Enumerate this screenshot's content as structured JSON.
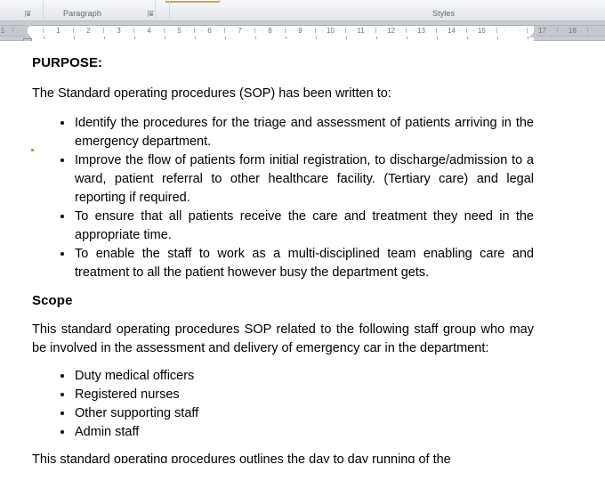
{
  "ribbon": {
    "groups": [
      {
        "label": "Paragraph",
        "launcher_icon": "dialog-launcher-icon"
      },
      {
        "label": "Styles",
        "launcher_icon": "dialog-launcher-icon"
      }
    ],
    "left_launcher_icon": "dialog-launcher-icon",
    "selected_style_thumbnail": "style-gallery-selected-thumbnail"
  },
  "ruler": {
    "unit_numbers": [
      "1",
      "2",
      "3",
      "4",
      "5",
      "6",
      "7",
      "8",
      "9",
      "10",
      "11",
      "12",
      "13",
      "14",
      "15",
      "17",
      "18"
    ],
    "minor_mark": "·",
    "medium_mark": "I",
    "left_indent_marker": "first-line-indent-marker",
    "hanging_indent_marker": "hanging-indent-marker",
    "left_margin_box": "left-indent-box-marker",
    "right_indent_marker": "right-indent-marker"
  },
  "document": {
    "heading_purpose": "PURPOSE:",
    "intro_paragraph": "The Standard operating procedures (SOP) has been written to:",
    "purpose_bullets": [
      "Identify the procedures for the triage and assessment of patients arriving in the emergency department.",
      "Improve the flow of patients form initial registration, to discharge/admission to a ward, patient referral to other healthcare facility. (Tertiary care) and legal reporting if required.",
      "To ensure that all patients receive the care and treatment they need in the appropriate time.",
      "To enable the staff to work as a multi-disciplined team enabling care and treatment to all the patient however busy the department gets."
    ],
    "heading_scope": "Scope",
    "scope_paragraph": "This standard operating procedures SOP related to the following staff group who may be involved in the assessment and delivery of emergency car in the department:",
    "scope_bullets": [
      "Duty medical officers",
      "Registered nurses",
      "Other supporting staff",
      "Admin staff"
    ],
    "trailing_paragraph": "This standard operating procedures outlines the day to day running of the"
  },
  "colors": {
    "ribbon_background": "#eceef1",
    "ruler_background": "#c9ccd3",
    "ruler_page_area": "#ffffff",
    "page_background": "#ffffff",
    "text": "#000000",
    "group_label": "#5c6672",
    "style_thumb_accent": "#c9a167",
    "comment_anchor": "#d08a2a"
  }
}
